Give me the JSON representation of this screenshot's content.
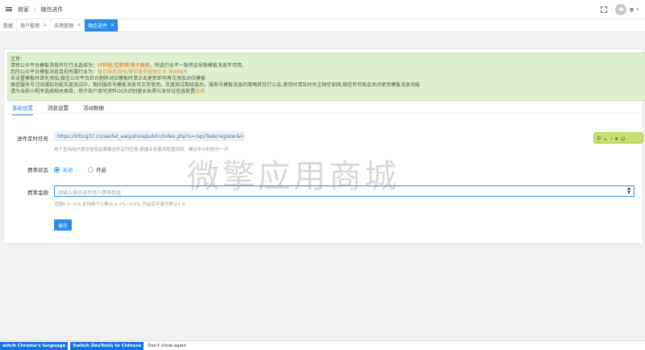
{
  "header": {
    "breadcrumb": [
      "商家",
      "微信进件"
    ],
    "user_name": "李"
  },
  "tabs": [
    {
      "label": "数据",
      "active": false,
      "closable": false
    },
    {
      "label": "商户管理",
      "active": false,
      "closable": true
    },
    {
      "label": "应用管理",
      "active": false,
      "closable": true
    },
    {
      "label": "微信进件",
      "active": true,
      "closable": true
    }
  ],
  "notice": {
    "title": "注意：",
    "line1_prefix": "请将公众平台模板消息所在行业选择为：",
    "line1_highlight": "IT科技/互联网|电子商务",
    "line1_suffix": "，所选行业不一致将会导致模板消息不可用。",
    "line2_prefix": "您的公众平台模板消息目前所属行业为：",
    "line2_highlight": "餐饮服务场所/餐饮服务管理企业 休闲娱乐",
    "line3": "未设置模板时请先添加,微信公众平台后台删除对应模板时请点击更新即可再次添加对应模板",
    "line4": "微信服务号订阅通知功能灰度测试中，期间服务号模板消息可正常使用。灰度测试期结束后，服务号模板消息的策略将另行公告,使用时请及时关注微信官网,微信有可能会关闭使用模板消息功能",
    "line5_prefix": "请为当前小程序选择相关类目，用于商户填写资料OCR识别营业执照与身份证信息配置",
    "line5_link": "链接"
  },
  "subtabs": [
    {
      "label": "基础设置",
      "active": true
    },
    {
      "label": "消息设置",
      "active": false
    },
    {
      "label": "活动数据",
      "active": false
    }
  ],
  "form": {
    "task_label": "进件定时任务",
    "task_url": "https://klting37.cn/sanfat_easystore/public/index.php?s=/api/Task/register&i=0",
    "task_hint": "用于查询商户提交信息结果做进件定时任务,根据业务量来配置时间，建议半小时执行一次",
    "rate_status_label": "费率状态",
    "rate_off": "关闭",
    "rate_on": "开启",
    "rate_amount_label": "费率金额",
    "rate_placeholder": "请输入微信进件商户费率数值",
    "rate_hint": "范围0.2~0.6,支持两个小数点,0.2%~0.6%,开启后不填写默认0.6",
    "save_label": "保存"
  },
  "widget": {
    "text": "中 ↘ ☽ ❦ ☺"
  },
  "watermark": "微擎应用商城",
  "bottombar": {
    "btn1": "witch Chrome's language",
    "btn2": "Switch DevTools to Chinese",
    "text": "Don't show again"
  }
}
